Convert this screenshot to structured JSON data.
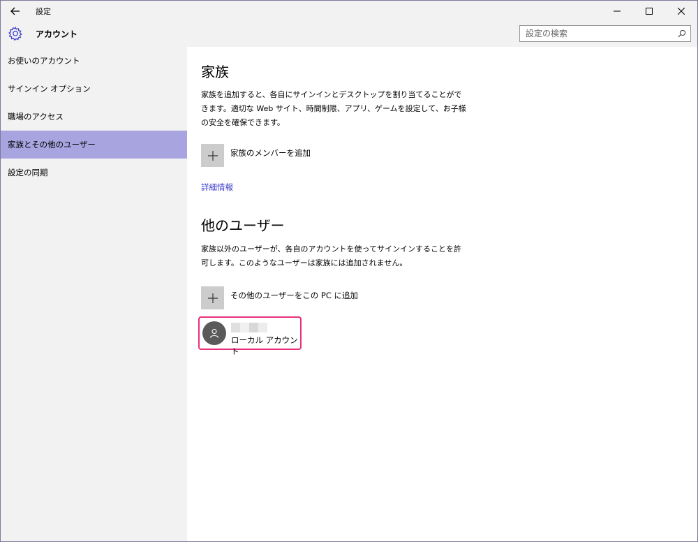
{
  "titlebar": {
    "title": "設定"
  },
  "header": {
    "title": "アカウント",
    "search_placeholder": "設定の検索"
  },
  "sidebar": {
    "items": [
      {
        "label": "お使いのアカウント"
      },
      {
        "label": "サインイン オプション"
      },
      {
        "label": "職場のアクセス"
      },
      {
        "label": "家族とその他のユーザー",
        "active": true
      },
      {
        "label": "設定の同期"
      }
    ]
  },
  "family": {
    "title": "家族",
    "description": "家族を追加すると、各自にサインインとデスクトップを割り当てることができます。適切な Web サイト、時間制限、アプリ、ゲームを設定して、お子様の安全を確保できます。",
    "add_label": "家族のメンバーを追加",
    "more_info": "詳細情報"
  },
  "other_users": {
    "title": "他のユーザー",
    "description": "家族以外のユーザーが、各自のアカウントを使ってサインインすることを許可します。このようなユーザーは家族には追加されません。",
    "add_label": "その他のユーザーをこの PC に追加",
    "users": [
      {
        "account_type": "ローカル アカウント"
      }
    ]
  },
  "colors": {
    "accent": "#a8a4e0",
    "link": "#3b3bcc",
    "highlight_border": "#e8307a"
  }
}
